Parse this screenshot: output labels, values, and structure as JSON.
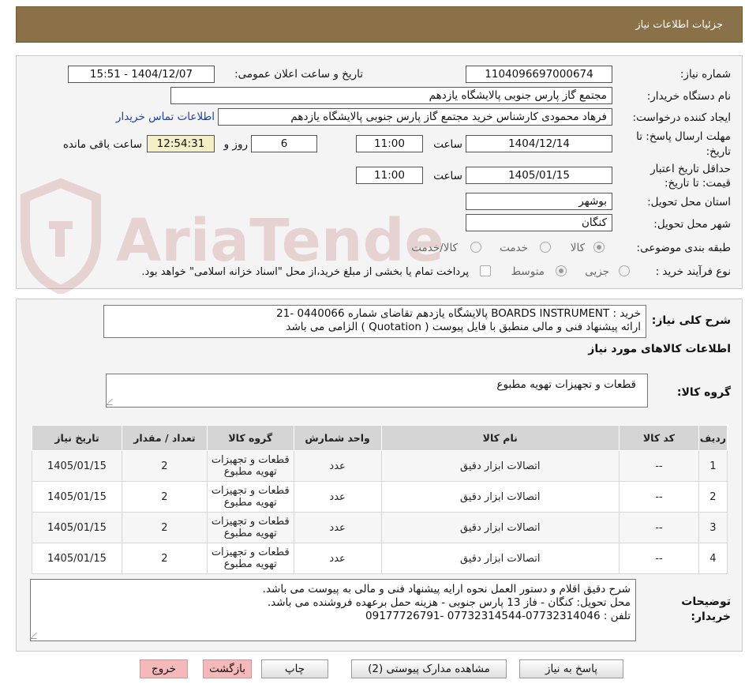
{
  "header": {
    "title": "جزئیات اطلاعات نیاز"
  },
  "form": {
    "need_number_label": "شماره نیاز:",
    "need_number": "1104096697000674",
    "announce_label": "تاریخ و ساعت اعلان عمومی:",
    "announce_value": "1404/12/07 - 15:51",
    "buyer_org_label": "نام دستگاه خریدار:",
    "buyer_org": "مجتمع گاز پارس جنوبی  پالایشگاه یازدهم",
    "creator_label": "ایجاد کننده درخواست:",
    "creator": "فرهاد محمودی کارشناس خرید مجتمع گاز پارس جنوبی  پالایشگاه یازدهم",
    "contact_link": "اطلاعات تماس خریدار",
    "deadline_label_1": "مهلت ارسال پاسخ: تا",
    "deadline_label_2": "تاریخ:",
    "deadline_date": "1404/12/14",
    "time_label": "ساعت",
    "deadline_time": "11:00",
    "days_value": "6",
    "days_label": "روز و",
    "remaining_time": "12:54:31",
    "remaining_label": "ساعت باقی مانده",
    "validity_label_1": "حداقل تاریخ اعتبار",
    "validity_label_2": "قیمت: تا تاریخ:",
    "validity_date": "1405/01/15",
    "validity_time": "11:00",
    "province_label": "استان محل تحویل:",
    "province": "بوشهر",
    "city_label": "شهر محل تحویل:",
    "city": "کنگان",
    "category_label": "طبقه بندی موضوعی:",
    "category_options": [
      "کالا",
      "خدمت",
      "کالا/خدمت"
    ],
    "process_label": "نوع فرآیند خرید :",
    "process_options": [
      "جزیی",
      "متوسط"
    ],
    "process_note": "پرداخت تمام یا بخشی از مبلغ خرید،از محل \"اسناد خزانه اسلامی\" خواهد بود."
  },
  "summary": {
    "label": "شرح کلی نیاز:",
    "line1": "خرید :  BOARDS INSTRUMENT  پالایشگاه یازدهم تقاضای شماره 0440066 -21",
    "line2": "ارائه پیشنهاد فنی و مالی منطبق با فایل پیوست ( Quotation ) الزامی می باشد"
  },
  "goods": {
    "section_title": "اطلاعات کالاهای مورد نیاز",
    "group_label": "گروه کالا:",
    "group_value": "قطعات و تجهیزات تهویه مطبوع"
  },
  "table": {
    "headers": [
      "ردیف",
      "کد کالا",
      "نام کالا",
      "واحد شمارش",
      "گروه کالا",
      "تعداد / مقدار",
      "تاریخ نیاز"
    ],
    "rows": [
      {
        "row": "1",
        "code": "--",
        "name": "اتصالات ابزار دقیق",
        "unit": "عدد",
        "group_1": "قطعات و تجهیزات",
        "group_2": "تهویه مطبوع",
        "qty": "2",
        "date": "1405/01/15"
      },
      {
        "row": "2",
        "code": "--",
        "name": "اتصالات ابزار دقیق",
        "unit": "عدد",
        "group_1": "قطعات و تجهیزات",
        "group_2": "تهویه مطبوع",
        "qty": "2",
        "date": "1405/01/15"
      },
      {
        "row": "3",
        "code": "--",
        "name": "اتصالات ابزار دقیق",
        "unit": "عدد",
        "group_1": "قطعات و تجهیزات",
        "group_2": "تهویه مطبوع",
        "qty": "2",
        "date": "1405/01/15"
      },
      {
        "row": "4",
        "code": "--",
        "name": "اتصالات ابزار دقیق",
        "unit": "عدد",
        "group_1": "قطعات و تجهیزات",
        "group_2": "تهویه مطبوع",
        "qty": "2",
        "date": "1405/01/15"
      }
    ]
  },
  "notes": {
    "label_1": "توضیحات",
    "label_2": "خریدار:",
    "lines": [
      "شرح دقیق اقلام و دستور العمل نحوه ارایه پیشنهاد فنی و مالی به پیوست می باشد.",
      "محل تحویل: کنگان - فاز 13 پارس جنوبی - هزینه حمل برعهده فروشنده می باشد.",
      "تلفن : 07732314046-07732314544 -09177726791"
    ]
  },
  "buttons": {
    "reply": "پاسخ به نیاز",
    "attachments": "مشاهده مدارک پیوستی (2)",
    "print": "چاپ",
    "back": "بازگشت",
    "exit": "خروج"
  },
  "watermark": {
    "text": "AriaTender.neT"
  }
}
